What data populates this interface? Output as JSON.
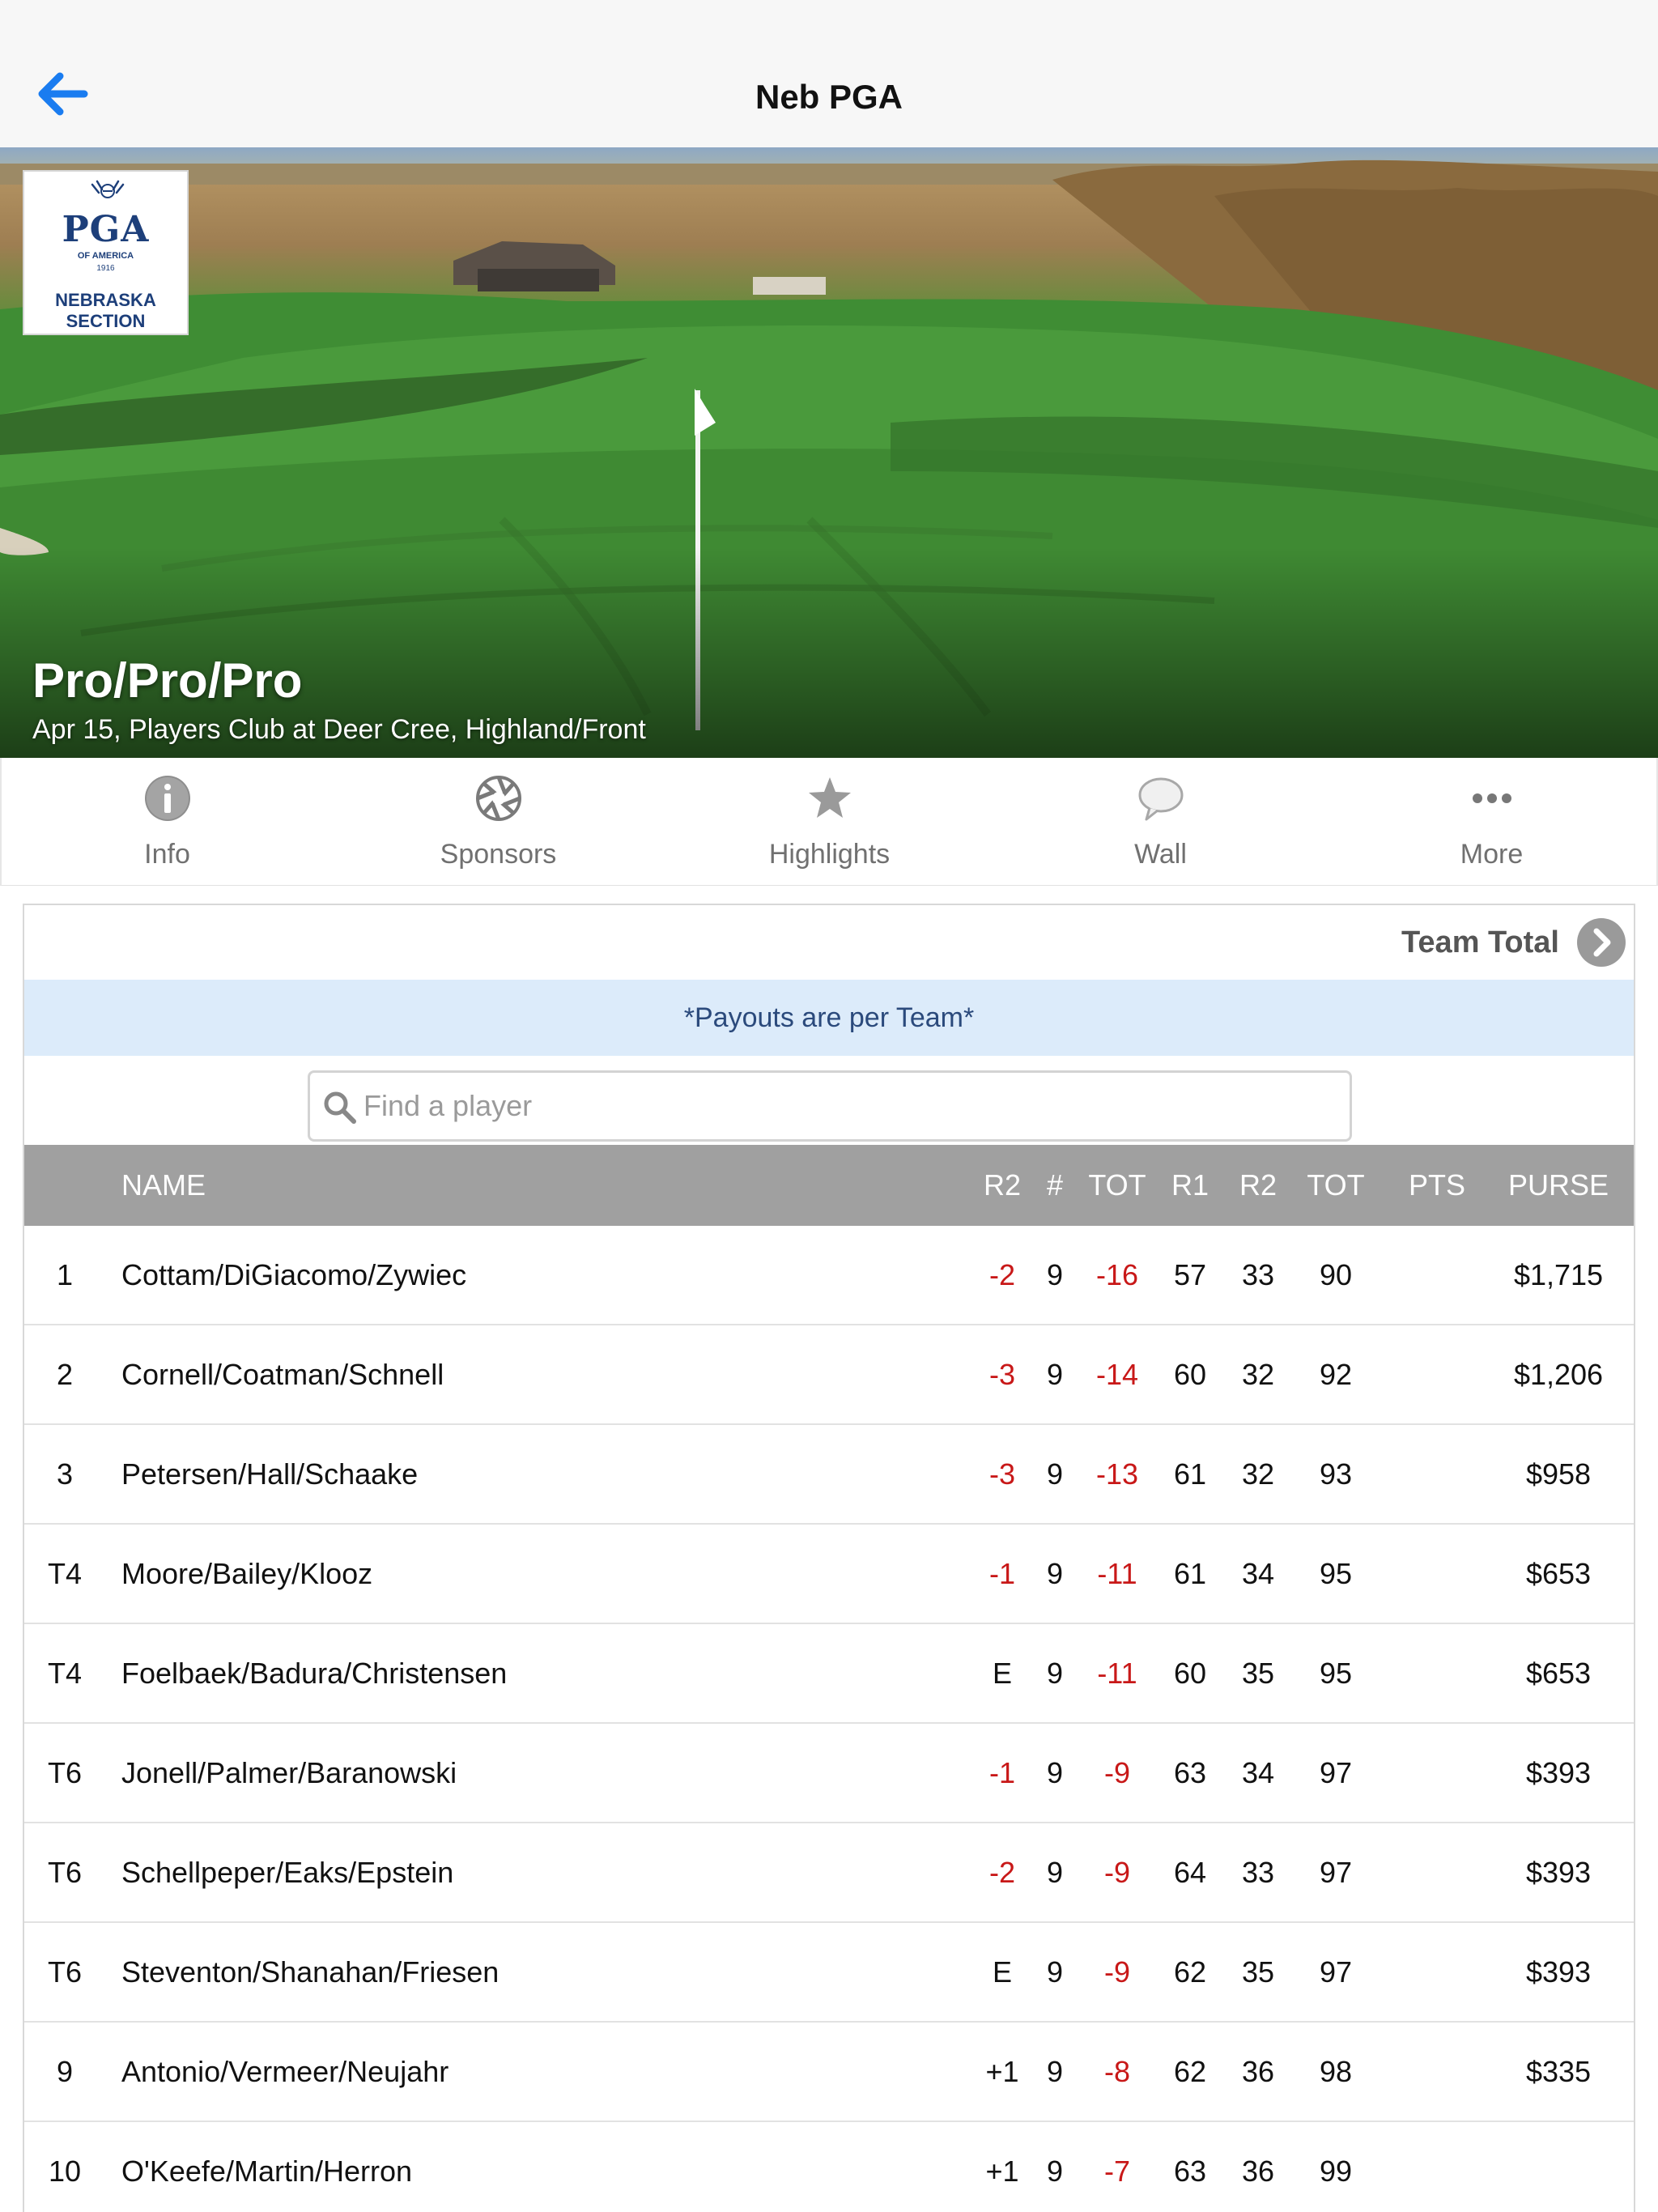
{
  "nav": {
    "title": "Neb PGA"
  },
  "hero": {
    "event_title": "Pro/Pro/Pro",
    "event_subtitle": "Apr 15, Players Club at Deer Cree, Highland/Front",
    "logo": {
      "line1": "PGA",
      "line2": "OF AMERICA",
      "year": "1916",
      "section1": "NEBRASKA",
      "section2": "SECTION"
    }
  },
  "tabs": [
    {
      "label": "Info",
      "icon": "info-icon"
    },
    {
      "label": "Sponsors",
      "icon": "aperture-icon"
    },
    {
      "label": "Highlights",
      "icon": "star-icon"
    },
    {
      "label": "Wall",
      "icon": "speech-bubble-icon"
    },
    {
      "label": "More",
      "icon": "ellipsis-icon"
    }
  ],
  "leaderboard": {
    "team_total_label": "Team Total",
    "notice": "*Payouts are per Team*",
    "search_placeholder": "Find a player",
    "columns": [
      "NAME",
      "R2",
      "#",
      "TOT",
      "R1",
      "R2",
      "TOT",
      "PTS",
      "PURSE"
    ],
    "rows": [
      {
        "pos": "1",
        "name": "Cottam/DiGiacomo/Zywiec",
        "today": "-2",
        "thru": "9",
        "topar": "-16",
        "r1": "57",
        "r2": "33",
        "tot": "90",
        "pts": "",
        "purse": "$1,715"
      },
      {
        "pos": "2",
        "name": "Cornell/Coatman/Schnell",
        "today": "-3",
        "thru": "9",
        "topar": "-14",
        "r1": "60",
        "r2": "32",
        "tot": "92",
        "pts": "",
        "purse": "$1,206"
      },
      {
        "pos": "3",
        "name": "Petersen/Hall/Schaake",
        "today": "-3",
        "thru": "9",
        "topar": "-13",
        "r1": "61",
        "r2": "32",
        "tot": "93",
        "pts": "",
        "purse": "$958"
      },
      {
        "pos": "T4",
        "name": "Moore/Bailey/Klooz",
        "today": "-1",
        "thru": "9",
        "topar": "-11",
        "r1": "61",
        "r2": "34",
        "tot": "95",
        "pts": "",
        "purse": "$653"
      },
      {
        "pos": "T4",
        "name": "Foelbaek/Badura/Christensen",
        "today": "E",
        "thru": "9",
        "topar": "-11",
        "r1": "60",
        "r2": "35",
        "tot": "95",
        "pts": "",
        "purse": "$653"
      },
      {
        "pos": "T6",
        "name": "Jonell/Palmer/Baranowski",
        "today": "-1",
        "thru": "9",
        "topar": "-9",
        "r1": "63",
        "r2": "34",
        "tot": "97",
        "pts": "",
        "purse": "$393"
      },
      {
        "pos": "T6",
        "name": "Schellpeper/Eaks/Epstein",
        "today": "-2",
        "thru": "9",
        "topar": "-9",
        "r1": "64",
        "r2": "33",
        "tot": "97",
        "pts": "",
        "purse": "$393"
      },
      {
        "pos": "T6",
        "name": "Steventon/Shanahan/Friesen",
        "today": "E",
        "thru": "9",
        "topar": "-9",
        "r1": "62",
        "r2": "35",
        "tot": "97",
        "pts": "",
        "purse": "$393"
      },
      {
        "pos": "9",
        "name": "Antonio/Vermeer/Neujahr",
        "today": "+1",
        "thru": "9",
        "topar": "-8",
        "r1": "62",
        "r2": "36",
        "tot": "98",
        "pts": "",
        "purse": "$335"
      },
      {
        "pos": "10",
        "name": "O'Keefe/Martin/Herron",
        "today": "+1",
        "thru": "9",
        "topar": "-7",
        "r1": "63",
        "r2": "36",
        "tot": "99",
        "pts": "",
        "purse": ""
      }
    ]
  },
  "colors": {
    "accent": "#1a7cf0",
    "negative": "#c81818",
    "header_bg": "#a0a0a0",
    "notice_bg": "#dcebfa"
  }
}
